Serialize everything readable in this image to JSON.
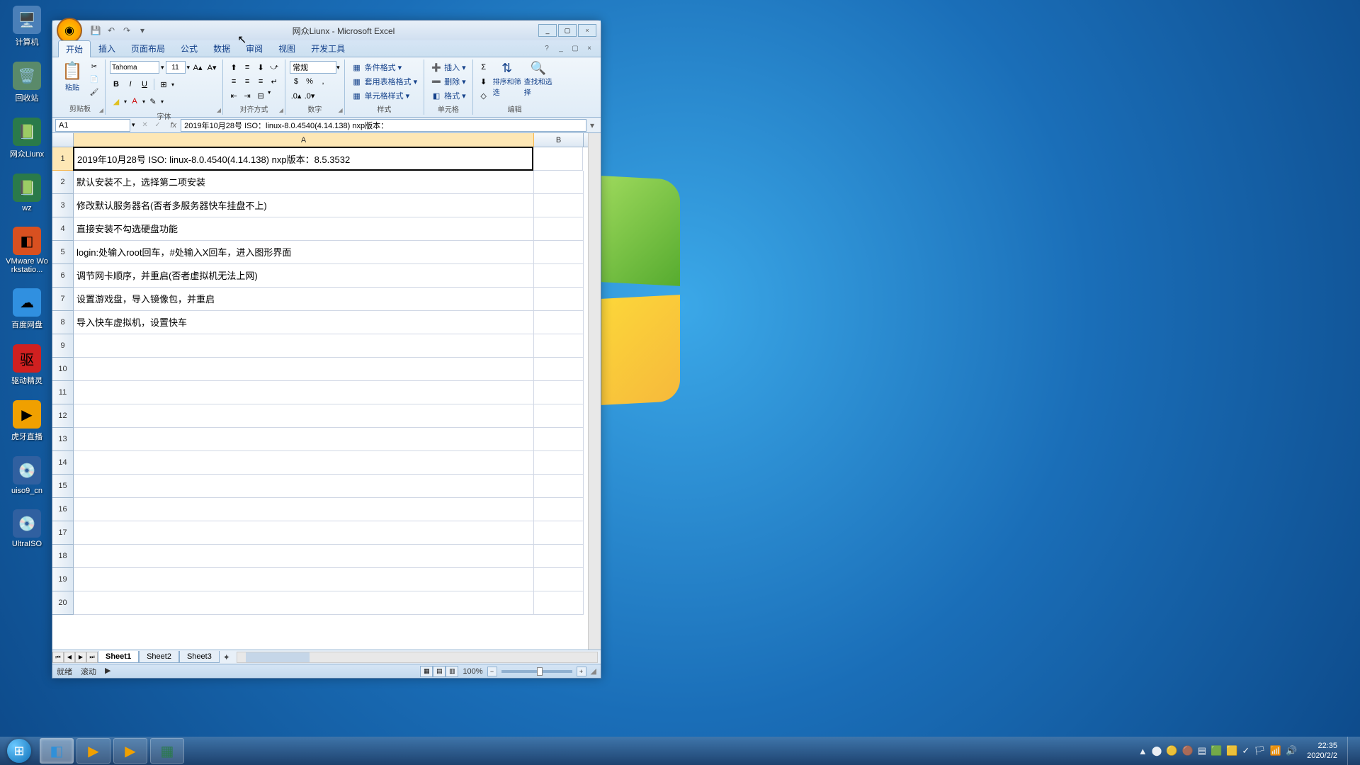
{
  "desktop_icons": [
    {
      "name": "computer",
      "label": "计算机",
      "color": "#4a7fb8",
      "glyph": "🖥️"
    },
    {
      "name": "recycle-bin",
      "label": "回收站",
      "color": "#5a8a6a",
      "glyph": "🗑️"
    },
    {
      "name": "file-1",
      "label": "网众Liunx",
      "color": "#2a7a4a",
      "glyph": "📗"
    },
    {
      "name": "file-wz",
      "label": "wz",
      "color": "#2a7a4a",
      "glyph": "📗"
    },
    {
      "name": "vmware",
      "label": "VMware Workstatio...",
      "color": "#d85020",
      "glyph": "◧"
    },
    {
      "name": "baidu-pan",
      "label": "百度网盘",
      "color": "#3090e0",
      "glyph": "☁"
    },
    {
      "name": "driver",
      "label": "驱动精灵",
      "color": "#d02020",
      "glyph": "驱"
    },
    {
      "name": "huya",
      "label": "虎牙直播",
      "color": "#f0a000",
      "glyph": "▶"
    },
    {
      "name": "uiso",
      "label": "uiso9_cn",
      "color": "#3060a0",
      "glyph": "💿"
    },
    {
      "name": "ultraiso",
      "label": "UltraISO",
      "color": "#3060a0",
      "glyph": "💿"
    }
  ],
  "window": {
    "title": "网众Liunx - Microsoft Excel",
    "min_tip": "_",
    "max_tip": "▢",
    "close_tip": "×"
  },
  "ribbon": {
    "tabs": [
      "开始",
      "插入",
      "页面布局",
      "公式",
      "数据",
      "审阅",
      "视图",
      "开发工具"
    ],
    "active_tab": 0,
    "help_glyph": "?",
    "groups": {
      "clipboard": {
        "label": "剪贴板",
        "paste": "粘贴"
      },
      "font": {
        "label": "字体",
        "name": "Tahoma",
        "size": "11"
      },
      "alignment": {
        "label": "对齐方式"
      },
      "number": {
        "label": "数字",
        "format": "常规"
      },
      "styles": {
        "label": "样式",
        "conditional": "条件格式",
        "table": "套用表格格式",
        "cell": "单元格样式"
      },
      "cells": {
        "label": "单元格",
        "insert": "插入",
        "delete": "删除",
        "format": "格式"
      },
      "editing": {
        "label": "编辑",
        "sort": "排序和筛选",
        "find": "查找和选择"
      }
    }
  },
  "formula_bar": {
    "name_box": "A1",
    "fx": "fx",
    "formula": "2019年10月28号 ISO：linux-8.0.4540(4.14.138) nxp版本："
  },
  "sheet": {
    "columns": [
      "A",
      "B"
    ],
    "selected_cell": "A1",
    "rows": [
      {
        "n": 1,
        "A": "2019年10月28号 ISO: linux-8.0.4540(4.14.138) nxp版本：8.5.3532"
      },
      {
        "n": 2,
        "A": "默认安装不上，选择第二项安装"
      },
      {
        "n": 3,
        "A": "修改默认服务器名(否者多服务器快车挂盘不上)"
      },
      {
        "n": 4,
        "A": "直接安装不勾选硬盘功能"
      },
      {
        "n": 5,
        "A": "login:处输入root回车，#处输入X回车，进入图形界面"
      },
      {
        "n": 6,
        "A": "调节网卡顺序，并重启(否者虚拟机无法上网)"
      },
      {
        "n": 7,
        "A": "设置游戏盘，导入镜像包，并重启"
      },
      {
        "n": 8,
        "A": "导入快车虚拟机，设置快车"
      },
      {
        "n": 9,
        "A": ""
      },
      {
        "n": 10,
        "A": ""
      },
      {
        "n": 11,
        "A": ""
      },
      {
        "n": 12,
        "A": ""
      },
      {
        "n": 13,
        "A": ""
      },
      {
        "n": 14,
        "A": ""
      },
      {
        "n": 15,
        "A": ""
      },
      {
        "n": 16,
        "A": ""
      },
      {
        "n": 17,
        "A": ""
      },
      {
        "n": 18,
        "A": ""
      },
      {
        "n": 19,
        "A": ""
      },
      {
        "n": 20,
        "A": ""
      }
    ],
    "tabs": [
      "Sheet1",
      "Sheet2",
      "Sheet3"
    ],
    "active_sheet": 0
  },
  "status": {
    "ready": "就绪",
    "scroll": "滚动",
    "zoom": "100%"
  },
  "taskbar": {
    "buttons": [
      {
        "name": "vmware-task",
        "glyph": "◧",
        "color": "#3090d8",
        "active": true
      },
      {
        "name": "huya-task-1",
        "glyph": "▶",
        "color": "#f0a000"
      },
      {
        "name": "huya-task-2",
        "glyph": "▶",
        "color": "#f0a000"
      },
      {
        "name": "excel-task",
        "glyph": "▦",
        "color": "#2a7a4a"
      }
    ],
    "time": "22:35",
    "date": "2020/2/2"
  }
}
